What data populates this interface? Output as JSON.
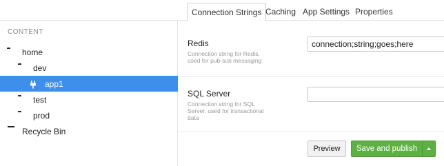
{
  "sidebar": {
    "section_title": "CONTENT",
    "items": [
      {
        "label": "home",
        "icon": "folder-icon",
        "active": false
      },
      {
        "label": "dev",
        "icon": "folder-icon",
        "active": false
      },
      {
        "label": "app1",
        "icon": "plug-icon",
        "active": true
      },
      {
        "label": "test",
        "icon": "folder-icon",
        "active": false
      },
      {
        "label": "prod",
        "icon": "folder-icon",
        "active": false
      },
      {
        "label": "Recycle Bin",
        "icon": "trash-icon",
        "active": false
      }
    ]
  },
  "tabs": [
    {
      "label": "Connection Strings",
      "active": true
    },
    {
      "label": "Caching",
      "active": false
    },
    {
      "label": "App Settings",
      "active": false
    },
    {
      "label": "Properties",
      "active": false
    }
  ],
  "properties": [
    {
      "label": "Redis",
      "description": "Connection string for Redis, used for pub-sub messaging",
      "value": "connection;string;goes;here"
    },
    {
      "label": "SQL Server",
      "description": "Connection string for SQL Server, used for transactional data",
      "value": ""
    }
  ],
  "actions": {
    "preview_label": "Preview",
    "publish_label": "Save and publish"
  },
  "colors": {
    "active_item": "#3d8fe8",
    "publish_button": "#5eb045"
  }
}
